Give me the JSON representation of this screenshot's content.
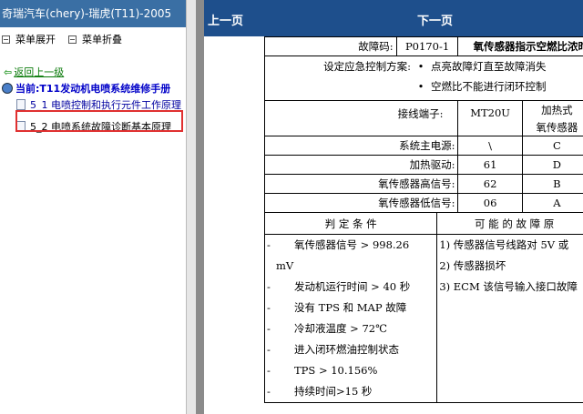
{
  "left_panel": {
    "title": "奇瑞汽车(chery)-瑞虎(T11)-2005",
    "menu_expand": "菜单展开",
    "menu_collapse": "菜单折叠",
    "back": "返回上一级",
    "current": "当前:T11发动机电喷系统维修手册",
    "items": [
      {
        "label": "5_1 电喷控制和执行元件工作原理"
      },
      {
        "label": "5_2 电喷系统故障诊断基本原理"
      }
    ]
  },
  "nav": {
    "prev": "上一页",
    "next": "下一页"
  },
  "doc": {
    "dtc_label": "故障码:",
    "dtc_code": "P0170-1",
    "dtc_desc": "氧传感器指示空燃比浓时",
    "emergency_label": "设定应急控制方案:",
    "emergency": [
      "点亮故障灯直至故障消失",
      "空燃比不能进行闭环控制"
    ],
    "terminal_label": "接线端子:",
    "col1": "MT20U",
    "col2_line1": "加热式",
    "col2_line2": "氧传感器",
    "rows": [
      {
        "name": "系统主电源:",
        "v1": "\\",
        "v2": "C"
      },
      {
        "name": "加热驱动:",
        "v1": "61",
        "v2": "D"
      },
      {
        "name": "氧传感器高信号:",
        "v1": "62",
        "v2": "B"
      },
      {
        "name": "氧传感器低信号:",
        "v1": "06",
        "v2": "A"
      }
    ],
    "cond_header": "判 定 条 件",
    "cause_header": "可 能 的 故 障 原",
    "conditions": [
      "氧传感器信号  > 998.26",
      "mV",
      "发动机运行时间 > 40 秒",
      "没有 TPS 和 MAP 故障",
      "冷却液温度 > 72℃",
      "进入闭环燃油控制状态",
      "TPS > 10.156%",
      "持续时间>15 秒"
    ],
    "causes": [
      "1) 传感器信号线路对 5V 或",
      "2) 传感器损坏",
      "3) ECM 该信号输入接口故障"
    ]
  }
}
